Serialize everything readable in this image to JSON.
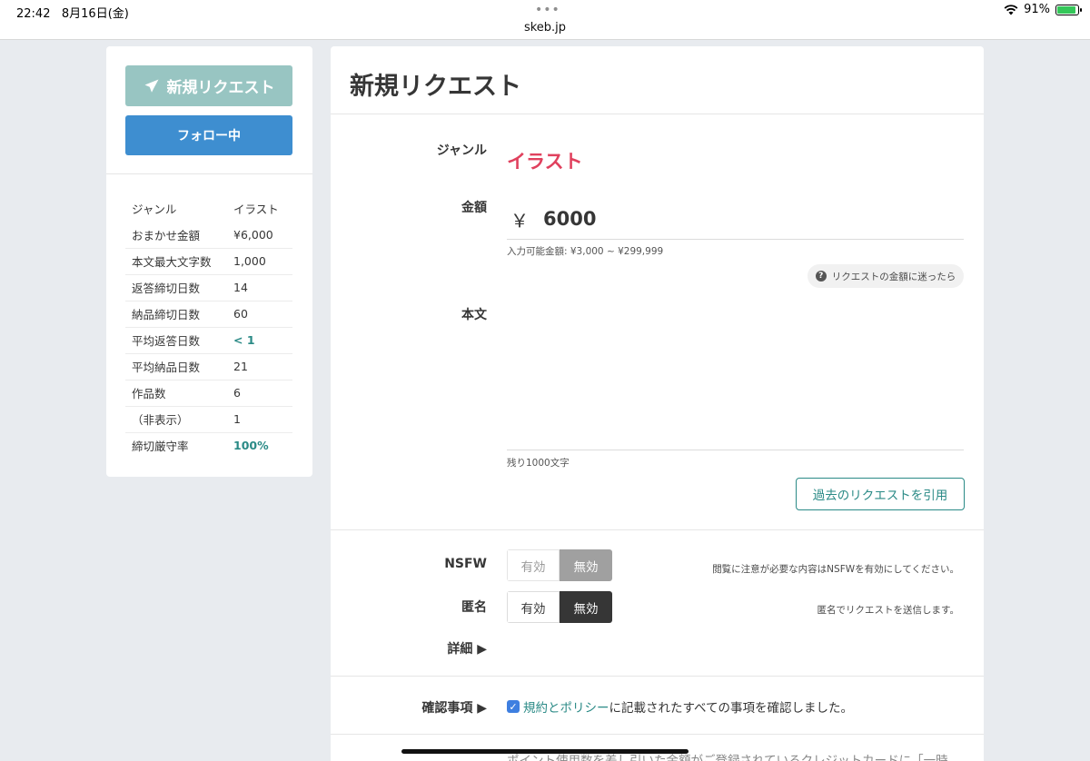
{
  "statusbar": {
    "time": "22:42",
    "date": "8月16日(金)",
    "dots": "•••",
    "url": "skeb.jp",
    "battery_text": "91%",
    "battery_level": 0.91
  },
  "side": {
    "new_request_label": "新規リクエスト",
    "follow_label": "フォロー中",
    "stats": [
      {
        "key": "ジャンル",
        "value": "イラスト"
      },
      {
        "key": "おまかせ金額",
        "value": "¥6,000"
      },
      {
        "key": "本文最大文字数",
        "value": "1,000"
      },
      {
        "key": "返答締切日数",
        "value": "14"
      },
      {
        "key": "納品締切日数",
        "value": "60"
      },
      {
        "key": "平均返答日数",
        "value": "< 1"
      },
      {
        "key": "平均納品日数",
        "value": "21"
      },
      {
        "key": "作品数",
        "value": "6"
      },
      {
        "key": "（非表示）",
        "value": "1"
      },
      {
        "key": "締切厳守率",
        "value": "100%"
      }
    ]
  },
  "main": {
    "title": "新規リクエスト",
    "genre_label": "ジャンル",
    "genre_value": "イラスト",
    "amount_label": "金額",
    "currency": "￥",
    "amount_value": "6000",
    "amount_hint": "入力可能金額: ¥3,000 ~ ¥299,999",
    "amount_help": "リクエストの金額に迷ったら",
    "body_label": "本文",
    "body_value": "",
    "remaining": "残り1000文字",
    "cite_button": "過去のリクエストを引用",
    "nsfw_label": "NSFW",
    "nsfw_on": "有効",
    "nsfw_off": "無効",
    "nsfw_note": "閲覧に注意が必要な内容はNSFWを有効にしてください。",
    "anon_label": "匿名",
    "anon_on": "有効",
    "anon_off": "無効",
    "anon_note": "匿名でリクエストを送信します。",
    "details_label": "詳細 ▶",
    "confirm_label": "確認事項 ▶",
    "confirm_link": "規約とポリシー",
    "confirm_text": "に記載されたすべての事項を確認しました。",
    "bottom_cut_text": "ポイント使用数を差し引いた金額がご登録されているクレジットカードに「一時"
  },
  "colors": {
    "accent": "#2a8a86",
    "genre": "#e0415e",
    "follow": "#3e8ed0",
    "new_request": "#98c5c2"
  }
}
